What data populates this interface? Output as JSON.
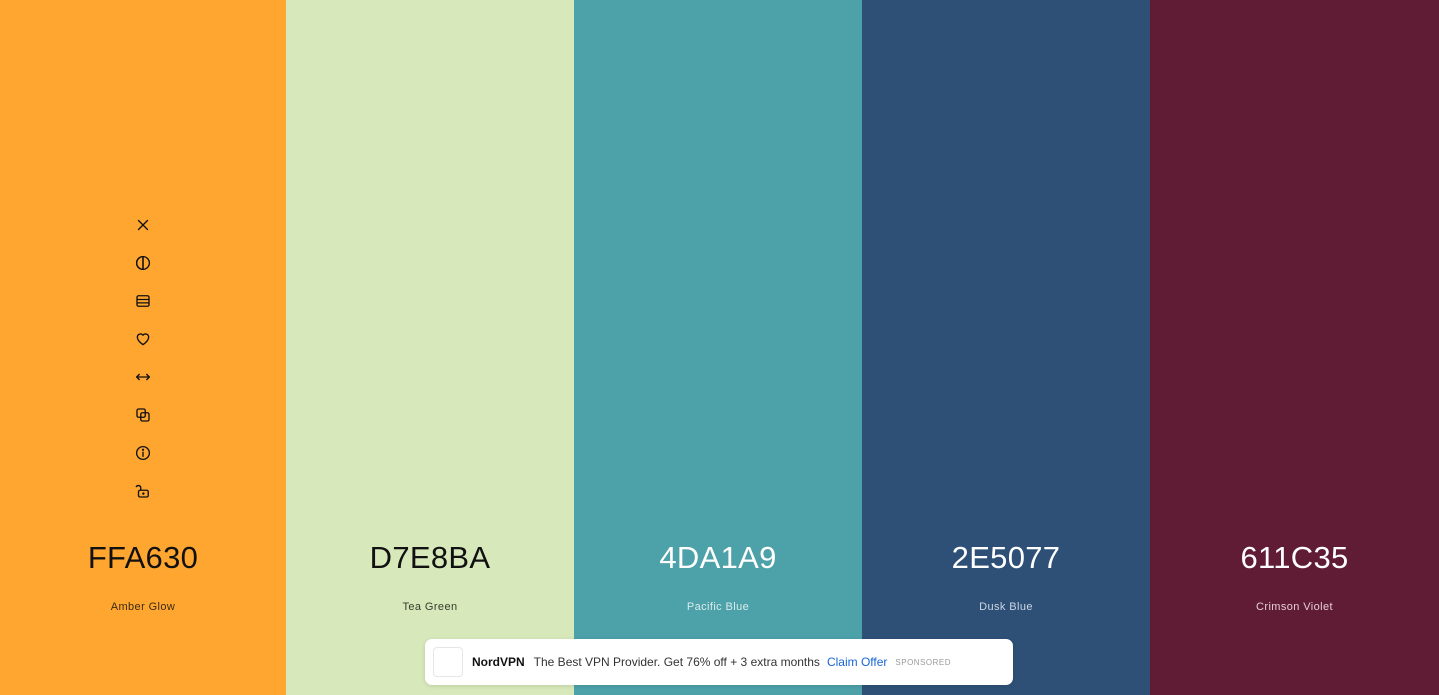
{
  "palette": [
    {
      "hex": "FFA630",
      "name": "Amber Glow",
      "bg": "#FFA630",
      "fg": "#111111",
      "sub": "#3d2a10"
    },
    {
      "hex": "D7E8BA",
      "name": "Tea Green",
      "bg": "#D7E8BA",
      "fg": "#111111",
      "sub": "#353d2b"
    },
    {
      "hex": "4DA1A9",
      "name": "Pacific Blue",
      "bg": "#4DA1A9",
      "fg": "#ffffff",
      "sub": "#d9ecee"
    },
    {
      "hex": "2E5077",
      "name": "Dusk Blue",
      "bg": "#2E5077",
      "fg": "#ffffff",
      "sub": "#cbd6e3"
    },
    {
      "hex": "611C35",
      "name": "Crimson Violet",
      "bg": "#611C35",
      "fg": "#ffffff",
      "sub": "#e3cdd4"
    }
  ],
  "toolbar": {
    "icons": [
      "close-icon",
      "contrast-icon",
      "shades-icon",
      "heart-icon",
      "drag-arrows-icon",
      "copy-icon",
      "info-icon",
      "unlock-icon"
    ]
  },
  "ad": {
    "brand": "NordVPN",
    "text": "The Best VPN Provider. Get 76% off + 3 extra months",
    "cta": "Claim Offer",
    "tag": "SPONSORED"
  }
}
